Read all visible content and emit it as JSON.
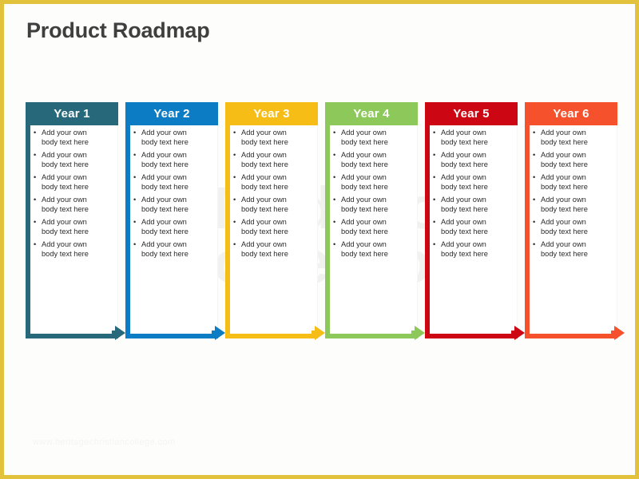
{
  "slide": {
    "title": "Product Roadmap",
    "frame_color": "#e2c13c",
    "background": "#ffffff"
  },
  "watermarks": {
    "center_line1": "Made for",
    "center_line2": "PowerPoint",
    "bottom": "www.heritagechristiancollege.com"
  },
  "roadmap": {
    "bullet_glyph": "•",
    "columns": [
      {
        "label": "Year 1",
        "color": "#27687a",
        "bullets": [
          {
            "line1": "Add your own",
            "line2": "body text here"
          },
          {
            "line1": "Add your own",
            "line2": "body text here"
          },
          {
            "line1": "Add your own",
            "line2": "body text here"
          },
          {
            "line1": "Add your own",
            "line2": "body text here"
          },
          {
            "line1": "Add your own",
            "line2": "body text here"
          },
          {
            "line1": "Add your own",
            "line2": "body text here"
          }
        ]
      },
      {
        "label": "Year 2",
        "color": "#0c7cc4",
        "bullets": [
          {
            "line1": "Add your own",
            "line2": "body text here"
          },
          {
            "line1": "Add your own",
            "line2": "body text here"
          },
          {
            "line1": "Add your own",
            "line2": "body text here"
          },
          {
            "line1": "Add your own",
            "line2": "body text here"
          },
          {
            "line1": "Add your own",
            "line2": "body text here"
          },
          {
            "line1": "Add your own",
            "line2": "body text here"
          }
        ]
      },
      {
        "label": "Year 3",
        "color": "#f6bd16",
        "bullets": [
          {
            "line1": "Add your own",
            "line2": "body text here"
          },
          {
            "line1": "Add your own",
            "line2": "body text here"
          },
          {
            "line1": "Add your own",
            "line2": "body text here"
          },
          {
            "line1": "Add your own",
            "line2": "body text here"
          },
          {
            "line1": "Add your own",
            "line2": "body text here"
          },
          {
            "line1": "Add your own",
            "line2": "body text here"
          }
        ]
      },
      {
        "label": "Year 4",
        "color": "#8dc95a",
        "bullets": [
          {
            "line1": "Add your own",
            "line2": "body text here"
          },
          {
            "line1": "Add your own",
            "line2": "body text here"
          },
          {
            "line1": "Add your own",
            "line2": "body text here"
          },
          {
            "line1": "Add your own",
            "line2": "body text here"
          },
          {
            "line1": "Add your own",
            "line2": "body text here"
          },
          {
            "line1": "Add your own",
            "line2": "body text here"
          }
        ]
      },
      {
        "label": "Year 5",
        "color": "#cc0713",
        "bullets": [
          {
            "line1": "Add your own",
            "line2": "body text here"
          },
          {
            "line1": "Add your own",
            "line2": "body text here"
          },
          {
            "line1": "Add your own",
            "line2": "body text here"
          },
          {
            "line1": "Add your own",
            "line2": "body text here"
          },
          {
            "line1": "Add your own",
            "line2": "body text here"
          },
          {
            "line1": "Add your own",
            "line2": "body text here"
          }
        ]
      },
      {
        "label": "Year 6",
        "color": "#f4512c",
        "bullets": [
          {
            "line1": "Add your own",
            "line2": "body text here"
          },
          {
            "line1": "Add your own",
            "line2": "body text here"
          },
          {
            "line1": "Add your own",
            "line2": "body text here"
          },
          {
            "line1": "Add your own",
            "line2": "body text here"
          },
          {
            "line1": "Add your own",
            "line2": "body text here"
          },
          {
            "line1": "Add your own",
            "line2": "body text here"
          }
        ]
      }
    ]
  }
}
